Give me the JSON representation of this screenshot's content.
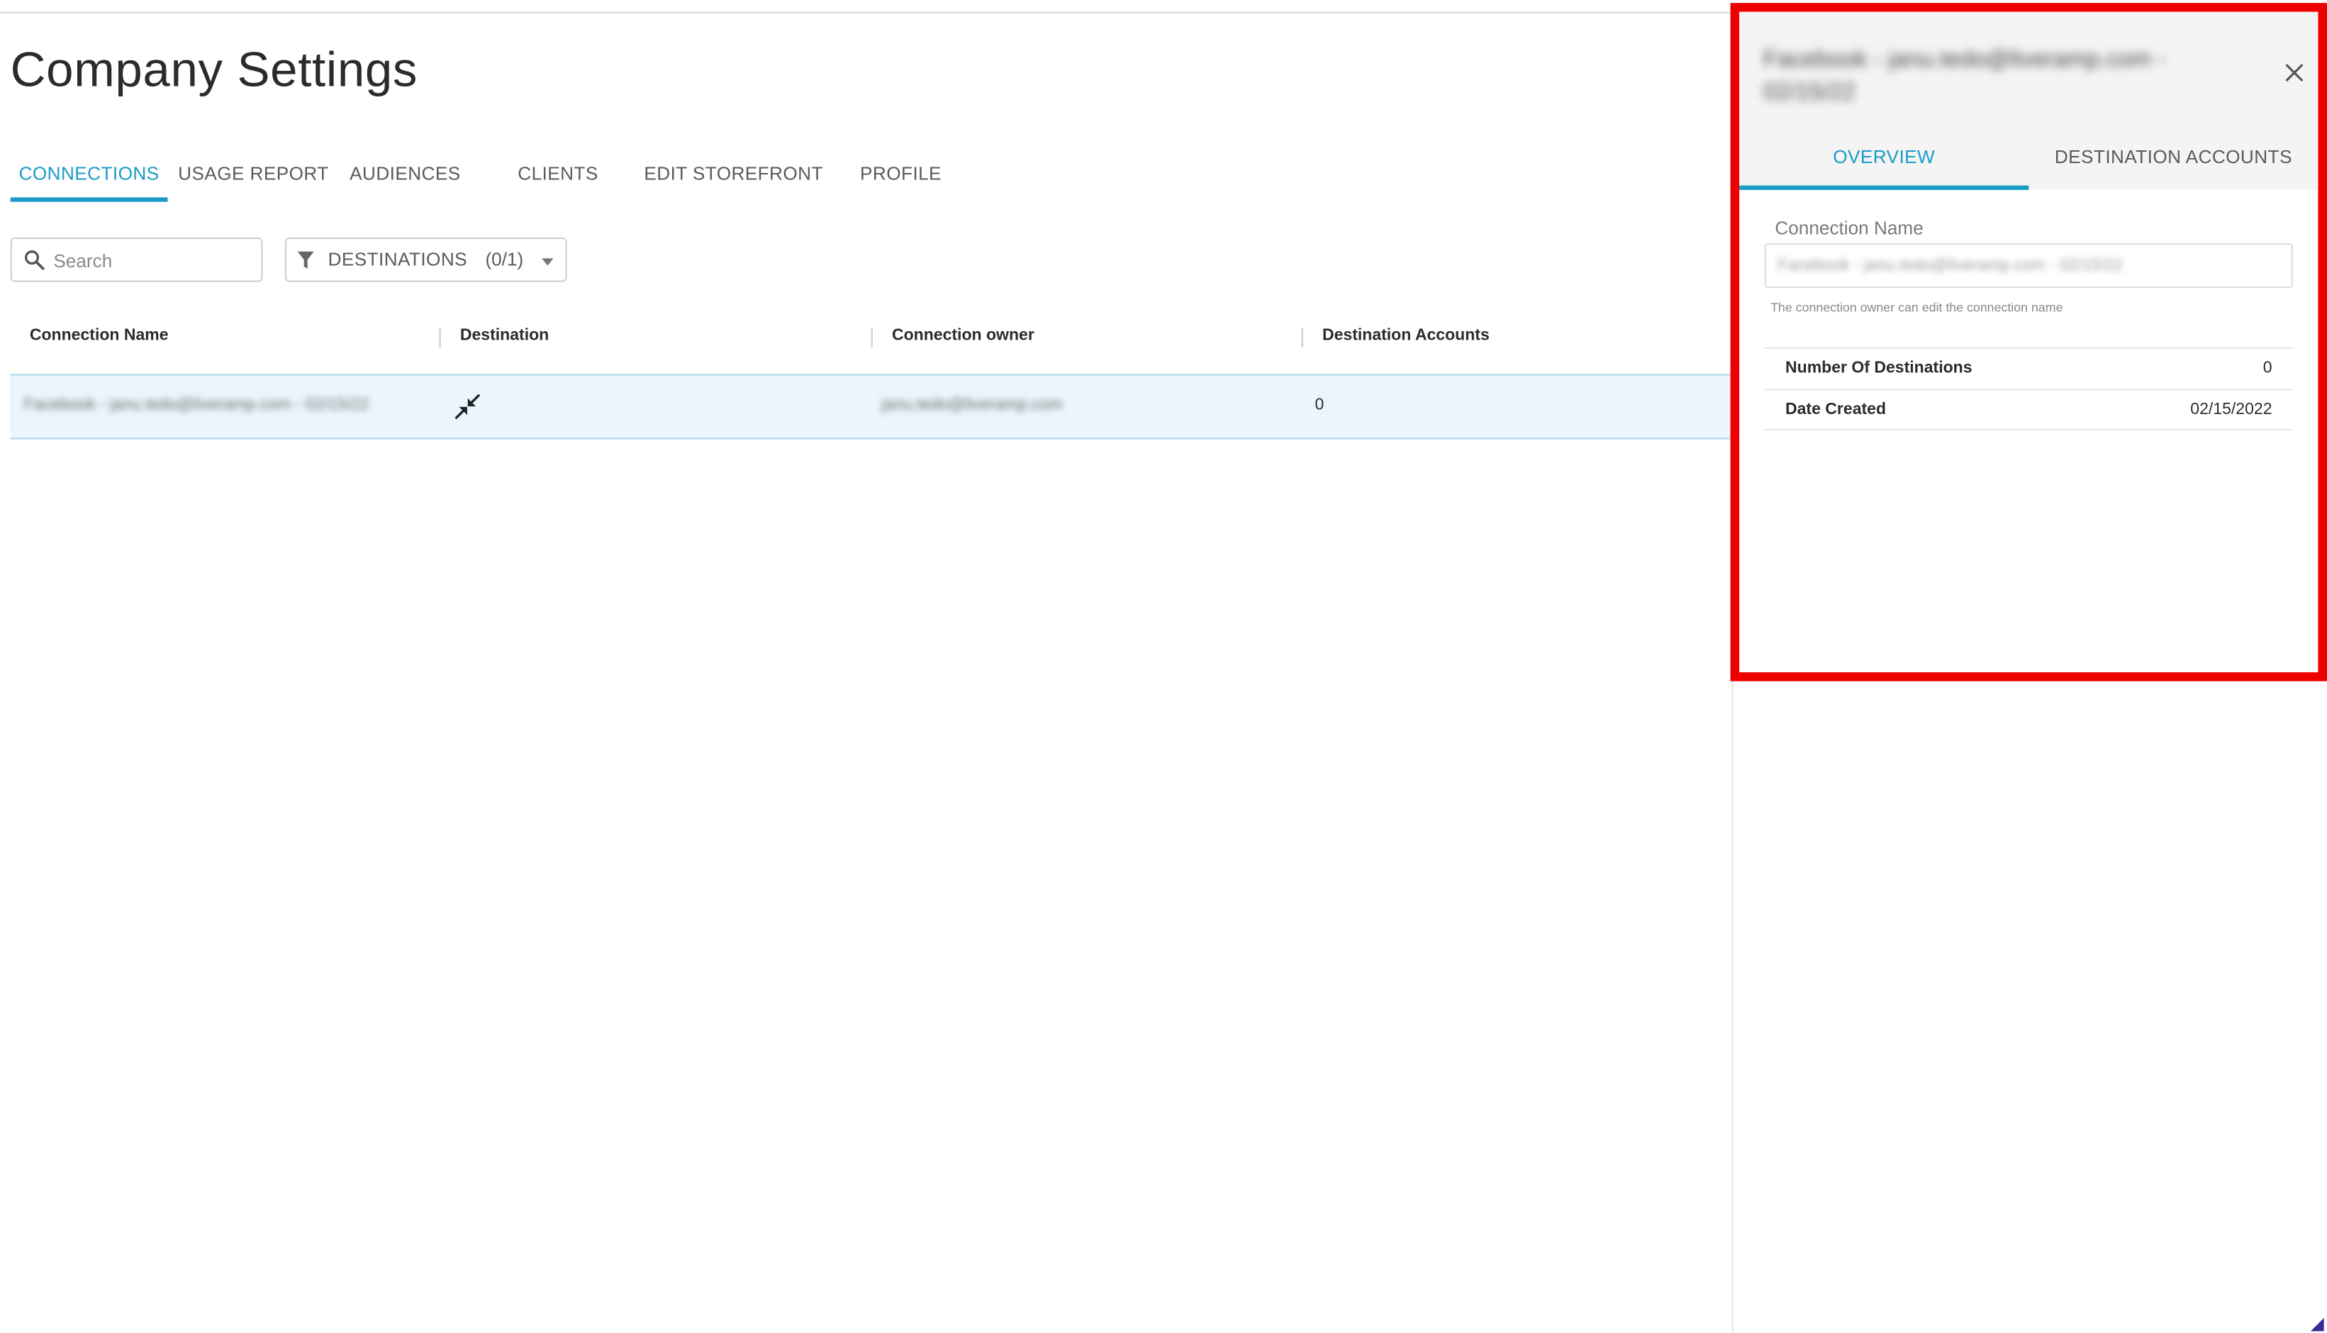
{
  "page": {
    "title": "Company Settings"
  },
  "tabs": [
    {
      "label": "CONNECTIONS",
      "active": true
    },
    {
      "label": "USAGE REPORT",
      "active": false
    },
    {
      "label": "AUDIENCES",
      "active": false
    },
    {
      "label": "CLIENTS",
      "active": false
    },
    {
      "label": "EDIT STOREFRONT",
      "active": false
    },
    {
      "label": "PROFILE",
      "active": false
    }
  ],
  "toolbar": {
    "search_placeholder": "Search",
    "filter_label": "DESTINATIONS",
    "filter_count": "(0/1)"
  },
  "table": {
    "columns": [
      "Connection Name",
      "Destination",
      "Connection owner",
      "Destination Accounts"
    ],
    "rows": [
      {
        "connection_name": "Facebook - janu.tedo@liveramp.com - 02/15/22",
        "destination_icon": "compress-arrows-icon",
        "owner": "janu.tedo@liveramp.com",
        "destination_accounts": "0"
      }
    ]
  },
  "panel": {
    "title": "Facebook - janu.tedo@liveramp.com - 02/15/22",
    "tabs": [
      {
        "label": "OVERVIEW",
        "active": true
      },
      {
        "label": "DESTINATION ACCOUNTS",
        "active": false
      }
    ],
    "connection_name_label": "Connection Name",
    "connection_name_value": "Facebook - janu.tedo@liveramp.com - 02/15/22",
    "helper_text": "The connection owner can edit the connection name",
    "details": [
      {
        "label": "Number Of Destinations",
        "value": "0"
      },
      {
        "label": "Date Created",
        "value": "02/15/2022"
      }
    ]
  },
  "colors": {
    "accent": "#1a9bc8",
    "highlight_border": "#ee0000",
    "selected_row_bg": "#eaf6fb"
  }
}
